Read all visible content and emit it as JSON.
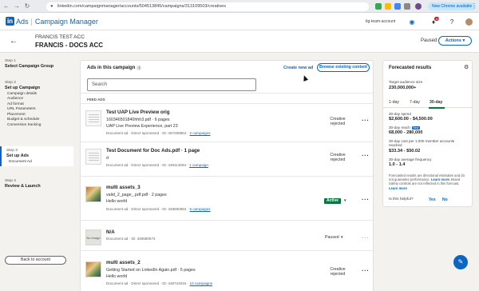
{
  "browser": {
    "url": "linkedin.com/campaignmanager/accounts/504513845/campaigns/313109503/creatives",
    "new_chrome_label": "New Chrome available"
  },
  "topbar": {
    "logo_ads": "Ads",
    "logo_product": "Campaign Manager",
    "account_name": "tig-team-account",
    "notif_count": "10"
  },
  "header": {
    "account_label": "FRANCIS TEST ACC",
    "campaign_title": "FRANCIS - DOCS ACC",
    "status": "Paused",
    "actions_label": "Actions"
  },
  "stepper": {
    "steps": [
      {
        "num": "Step 1",
        "title": "Select Campaign Group",
        "subs": []
      },
      {
        "num": "Step 2",
        "title": "Set up Campaign",
        "subs": [
          "Campaign details",
          "Audience",
          "Ad format",
          "URL Parameters",
          "Placement",
          "Budget & schedule",
          "Conversion tracking"
        ]
      },
      {
        "num": "Step 3",
        "title": "Set up Ads",
        "subs": [
          "Document Ad"
        ]
      },
      {
        "num": "Step 4",
        "title": "Review & Launch",
        "subs": []
      }
    ],
    "back_label": "Back to account"
  },
  "main": {
    "heading": "Ads in this campaign",
    "create_label": "Create new ad",
    "browse_label": "Browse existing content",
    "search_placeholder": "Search",
    "feed_label": "FEED ADS",
    "ads": [
      {
        "title": "Test UAP Live Preview orig",
        "file": "160346501840hhh3.pdf",
        "pages": "6 pages",
        "desc": "UAP Live Preview Experience, part 23",
        "type": "Document ad",
        "sponsor": "Direct sponsored",
        "id": "ID: 457269864",
        "campaigns": "2 campaigns",
        "status": "Creative rejected"
      },
      {
        "title": "Test Document for Doc Ads.pdf",
        "pages": "1 page",
        "desc": "d",
        "type": "Document ad",
        "sponsor": "Direct sponsored",
        "id": "ID: 449113094",
        "campaigns": "1 campaign",
        "status": "Creative rejected"
      },
      {
        "title": "multi assets_3",
        "file": "valid_2_page_.pdf.pdf",
        "pages": "2 pages",
        "desc": "Hello world",
        "type": "Document ad",
        "sponsor": "Direct sponsored",
        "id": "ID: 448660984",
        "campaigns": "6 campaigns",
        "status": "Active"
      },
      {
        "title": "N/A",
        "type": "Document ad",
        "id": "ID: 448680574",
        "status": "Paused",
        "thumb": "No image"
      },
      {
        "title": "multi assets_2",
        "file": "Getting Started on LinkedIn Again.pdf",
        "pages": "5 pages",
        "desc": "Hello world",
        "type": "Document ad",
        "sponsor": "Direct sponsored",
        "id": "ID: 448724034",
        "campaigns": "10 campaigns",
        "status": "Creative rejected"
      }
    ]
  },
  "forecast": {
    "title": "Forecasted results",
    "audience_label": "Target audience size",
    "audience_value": "230,000,000+",
    "tabs": [
      "1-day",
      "7-day",
      "30-day"
    ],
    "selected_tab": "30-day",
    "spend_label": "30-day spend",
    "spend_value": "$2,600.00 - $4,500.00",
    "reach_label": "30-day reach",
    "reach_badge": "New",
    "reach_value": "68,000 - 280,000",
    "cpm_label": "30-day cost per 1,000 member accounts reached",
    "cpm_value": "$33.34 - $50.02",
    "freq_label": "30-day average frequency",
    "freq_value": "1.0 - 1.4",
    "note": "Forecasted results are directional estimates and do not guarantee performance.",
    "note_link1": "Learn more.",
    "note2": "Brand Safety controls are not reflected in this forecast.",
    "note_link2": "Learn more",
    "helpful": "Is this helpful?",
    "yes": "Yes",
    "no": "No"
  }
}
